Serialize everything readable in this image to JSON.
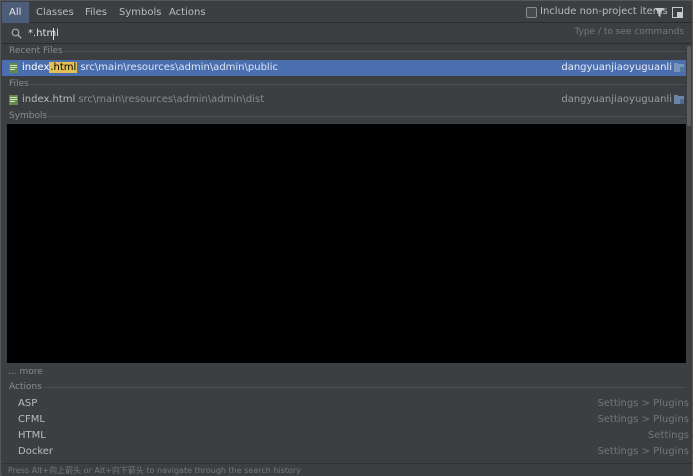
{
  "tabs": [
    {
      "label": "All",
      "active": true
    },
    {
      "label": "Classes",
      "active": false
    },
    {
      "label": "Files",
      "active": false
    },
    {
      "label": "Symbols",
      "active": false
    },
    {
      "label": "Actions",
      "active": false
    }
  ],
  "include_non_project": {
    "label": "Include non-project items",
    "checked": false
  },
  "search": {
    "value": "*.html",
    "hint": "Type / to see commands"
  },
  "sections": {
    "recent_files": "Recent Files",
    "files": "Files",
    "symbols": "Symbols",
    "actions": "Actions"
  },
  "recent_files": [
    {
      "name_prefix": "index",
      "name_match": ".html",
      "path": "src\\main\\resources\\admin\\admin\\public",
      "module": "dangyuanjiaoyuguanli",
      "selected": true
    }
  ],
  "files": [
    {
      "name": "index.html",
      "path": "src\\main\\resources\\admin\\admin\\dist",
      "module": "dangyuanjiaoyuguanli",
      "selected": false
    }
  ],
  "more_label": "... more",
  "actions": [
    {
      "name": "ASP",
      "category": "Settings > Plugins"
    },
    {
      "name": "CFML",
      "category": "Settings > Plugins"
    },
    {
      "name": "HTML",
      "category": "Settings"
    },
    {
      "name": "Docker",
      "category": "Settings > Plugins"
    }
  ],
  "footer": "Press Alt+向上箭头 or Alt+向下箭头 to navigate through the search history",
  "colors": {
    "background": "#3c3f41",
    "selection": "#4b6eaf",
    "active_tab": "#4b5d78",
    "match_highlight": "#e2c154"
  },
  "icons": {
    "search": "search-icon",
    "filter": "filter-icon",
    "pin": "pin-window-icon",
    "file": "html-file-icon",
    "module": "module-folder-icon"
  }
}
